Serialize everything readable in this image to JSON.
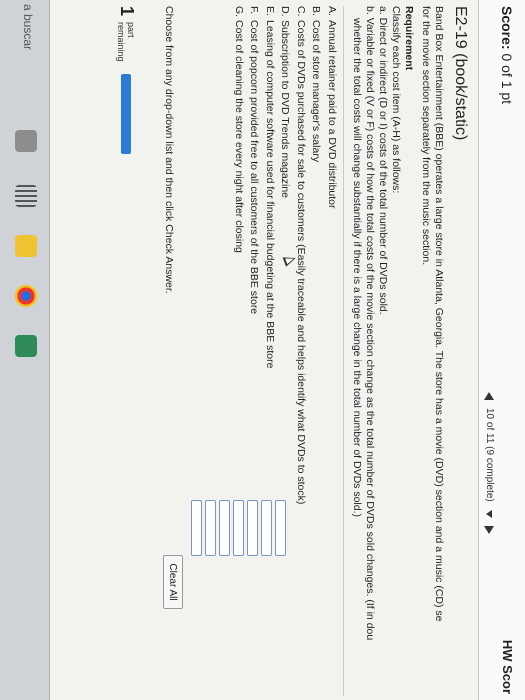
{
  "header": {
    "score_label": "Score:",
    "score_value": "0 of 1 pt",
    "hw_score": "HW Scor",
    "nav_status": "10 of 11 (9 complete)"
  },
  "question": {
    "title": "E2-19 (book/static)",
    "intro_line1": "Band Box Entertainment (BBE) operates a large store in Atlanta, Georgia. The store has a movie (DVD) section and a music (CD) se",
    "intro_line2": "for the movie section separately from the music section.",
    "requirement_heading": "Requirement",
    "requirement_line": "Classify each cost item (A-H) as follows:",
    "req_a": "a.  Direct or indirect (D or I) costs of the total number of DVDs sold.",
    "req_b1": "b.  Variable or fixed (V or F) costs of how the total costs of the movie section change as the total number of DVDs sold changes. (If in dou",
    "req_b2": "whether the total costs will change substantially if there is a large change in the total number of DVDs sold.)",
    "items": [
      {
        "letter": "A.",
        "text": "Annual retainer paid to a DVD distributor"
      },
      {
        "letter": "B.",
        "text": "Cost of store manager's salary"
      },
      {
        "letter": "C.",
        "text": "Costs of DVDs purchased for sale to customers (Easily traceable and helps identify what DVDs to stock)"
      },
      {
        "letter": "D.",
        "text": "Subscription to DVD Trends magazine"
      },
      {
        "letter": "E.",
        "text": "Leasing of computer software used for financial budgeting at the BBE store"
      },
      {
        "letter": "F.",
        "text": "Cost of popcorn provided free to all customers of the BBE store"
      },
      {
        "letter": "G.",
        "text": "Cost of cleaning the store every night after closing"
      }
    ],
    "instruction": "Choose from any drop-down list and then click Check Answer.",
    "clear_all": "Clear All"
  },
  "footer": {
    "part_number": "1",
    "part_label": "part",
    "remaining_label": "remaining"
  },
  "taskbar": {
    "search_text": "a buscar"
  },
  "progress": {
    "fraction": 0.0
  },
  "colors": {
    "progress_fill": "#2c7cd6",
    "input_border": "#7a93c8"
  }
}
